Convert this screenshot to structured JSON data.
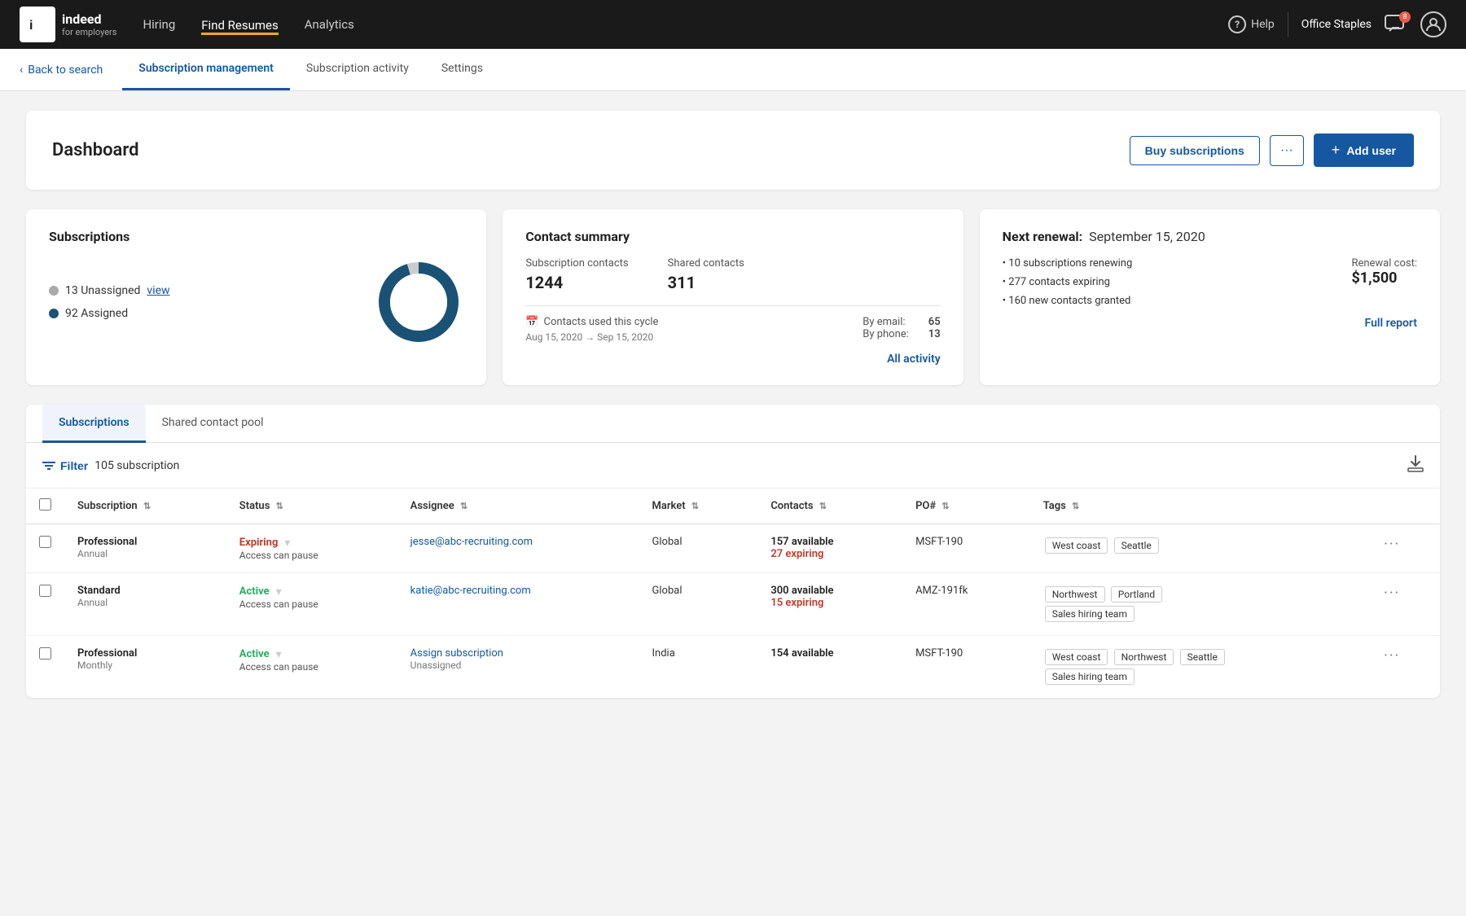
{
  "app": {
    "logo_text": "indeed",
    "logo_sub": "for employers"
  },
  "nav": {
    "links": [
      {
        "label": "Hiring",
        "active": false
      },
      {
        "label": "Find Resumes",
        "active": true
      },
      {
        "label": "Analytics",
        "active": false
      }
    ],
    "help": "Help",
    "office": "Office Staples",
    "chat_badge": "8"
  },
  "sub_nav": {
    "back_label": "Back to search",
    "tabs": [
      {
        "label": "Subscription management",
        "active": true
      },
      {
        "label": "Subscription activity",
        "active": false
      },
      {
        "label": "Settings",
        "active": false
      }
    ]
  },
  "dashboard": {
    "title": "Dashboard",
    "btn_buy": "Buy subscriptions",
    "btn_dots": "···",
    "btn_add_user": "Add user"
  },
  "subscriptions_card": {
    "title": "Subscriptions",
    "unassigned_count": "13 Unassigned",
    "view_link": "view",
    "assigned_count": "92 Assigned",
    "donut": {
      "total": 105,
      "assigned": 92,
      "unassigned": 13
    }
  },
  "contact_summary": {
    "title": "Contact summary",
    "subscription_contacts_label": "Subscription contacts",
    "subscription_contacts_value": "1244",
    "shared_contacts_label": "Shared contacts",
    "shared_contacts_value": "311",
    "cycle_label": "Contacts used this cycle",
    "cycle_dates": "Aug 15, 2020 → Sep 15, 2020",
    "by_email_label": "By email:",
    "by_email_value": "65",
    "by_phone_label": "By phone:",
    "by_phone_value": "13",
    "all_activity": "All activity"
  },
  "renewal": {
    "title": "Next renewal:",
    "date": "September 15, 2020",
    "items": [
      "• 10 subscriptions renewing",
      "• 277 contacts expiring",
      "• 160 new contacts granted"
    ],
    "cost_label": "Renewal cost:",
    "cost_value": "$1,500",
    "full_report": "Full report"
  },
  "table": {
    "tabs": [
      "Subscriptions",
      "Shared contact pool"
    ],
    "active_tab": "Subscriptions",
    "filter_label": "Filter",
    "count_label": "105 subscription",
    "columns": [
      "Subscription",
      "Status",
      "Assignee",
      "Market",
      "Contacts",
      "PO#",
      "Tags"
    ],
    "rows": [
      {
        "name": "Professional",
        "type": "Annual",
        "status": "Expiring",
        "status_class": "expiring",
        "status_sub": "Access can pause",
        "assignee": "jesse@abc-recruiting.com",
        "market": "Global",
        "contacts_available": "157 available",
        "contacts_expiring": "27 expiring",
        "po": "MSFT-190",
        "tags": [
          "West coast",
          "Seattle"
        ]
      },
      {
        "name": "Standard",
        "type": "Annual",
        "status": "Active",
        "status_class": "active",
        "status_sub": "Access can pause",
        "assignee": "katie@abc-recruiting.com",
        "market": "Global",
        "contacts_available": "300 available",
        "contacts_expiring": "15 expiring",
        "po": "AMZ-191fk",
        "tags": [
          "Northwest",
          "Portland",
          "Sales hiring team"
        ]
      },
      {
        "name": "Professional",
        "type": "Monthly",
        "status": "Active",
        "status_class": "active",
        "status_sub": "Access can pause",
        "assignee": "Assign subscription",
        "assignee_link": true,
        "assignee_sub": "Unassigned",
        "market": "India",
        "contacts_available": "154 available",
        "contacts_expiring": "",
        "po": "MSFT-190",
        "tags": [
          "West coast",
          "Northwest",
          "Seattle",
          "Sales hiring team"
        ]
      }
    ]
  }
}
